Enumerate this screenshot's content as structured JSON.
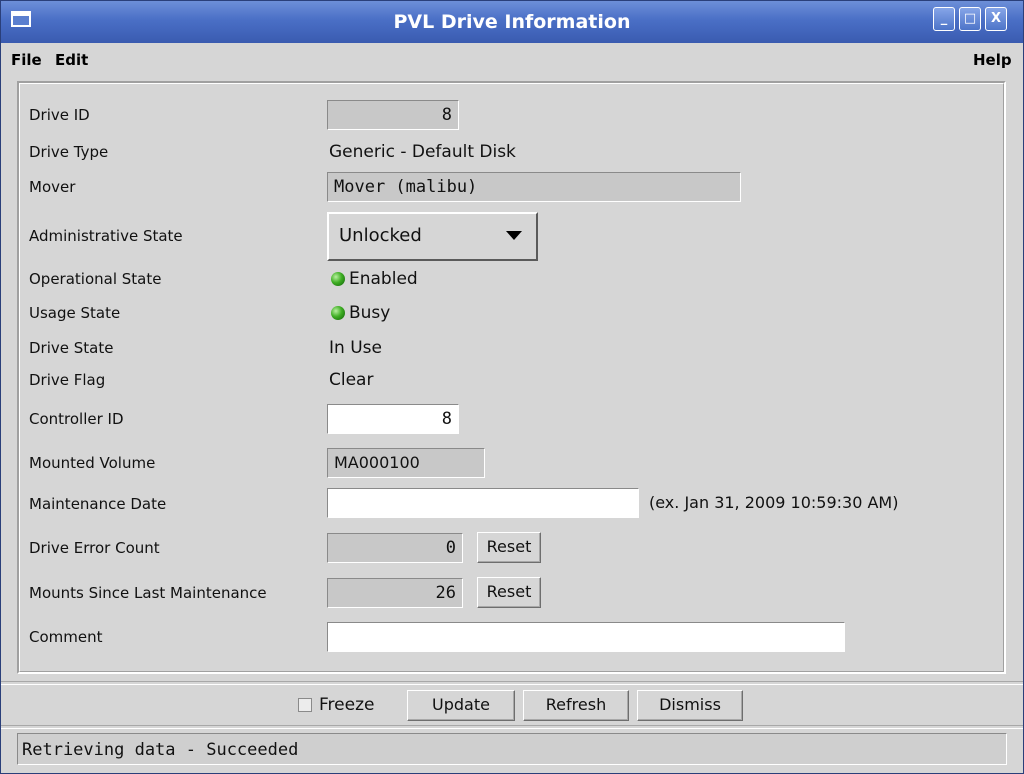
{
  "window": {
    "title": "PVL Drive Information",
    "buttons": [
      "_",
      "□",
      "X"
    ]
  },
  "menubar": {
    "file": "File",
    "edit": "Edit",
    "help": "Help"
  },
  "form": {
    "drive_id": {
      "label": "Drive ID",
      "value": "8"
    },
    "drive_type": {
      "label": "Drive Type",
      "value": "Generic - Default Disk"
    },
    "mover": {
      "label": "Mover",
      "value": "Mover (malibu)"
    },
    "admin_state": {
      "label": "Administrative State",
      "value": "Unlocked"
    },
    "operational_state": {
      "label": "Operational State",
      "value": "Enabled",
      "indicator_color": "#2e9e1c"
    },
    "usage_state": {
      "label": "Usage State",
      "value": "Busy",
      "indicator_color": "#2e9e1c"
    },
    "drive_state": {
      "label": "Drive State",
      "value": "In Use"
    },
    "drive_flag": {
      "label": "Drive Flag",
      "value": "Clear"
    },
    "controller_id": {
      "label": "Controller ID",
      "value": "8"
    },
    "mounted_volume": {
      "label": "Mounted Volume",
      "value": "MA000100"
    },
    "maintenance_date": {
      "label": "Maintenance Date",
      "value": "",
      "hint": "(ex. Jan 31, 2009 10:59:30 AM)"
    },
    "drive_error_count": {
      "label": "Drive Error Count",
      "value": "0",
      "reset_label": "Reset"
    },
    "mounts_since_maintenance": {
      "label": "Mounts Since Last Maintenance",
      "value": "26",
      "reset_label": "Reset"
    },
    "comment": {
      "label": "Comment",
      "value": ""
    }
  },
  "actions": {
    "freeze": "Freeze",
    "freeze_checked": false,
    "update": "Update",
    "refresh": "Refresh",
    "dismiss": "Dismiss"
  },
  "status": {
    "text": "Retrieving data - Succeeded"
  },
  "colors": {
    "titlebar": "#4a6fc6",
    "window_bg": "#d6d6d6",
    "readonly_field": "#c8c8c8"
  }
}
